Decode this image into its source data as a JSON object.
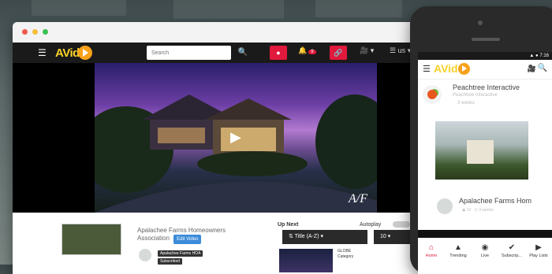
{
  "desktop": {
    "navbar": {
      "logo_text": "AVid",
      "search_placeholder": "Search",
      "notif_count": "9",
      "lang": "us"
    },
    "video": {
      "title": "Apalachee Farms Homeowners Association",
      "edit_label": "Edit Video",
      "channel_chip": "Apalachee Farms HOA",
      "subscribed_label": "Subscribed"
    },
    "up_next": {
      "label": "Up Next",
      "autoplay_label": "Autoplay",
      "sort_value": "Title (A-Z)",
      "count_value": "10",
      "next_title": "GLOBE",
      "next_meta": "Category"
    }
  },
  "phone": {
    "status_time": "7:16",
    "logo_text": "AVid",
    "channel": {
      "name": "Peachtree Interactive",
      "sub": "Peachtree Interactive",
      "time": "3 weeks"
    },
    "video": {
      "title": "Apalachee Farms Hom",
      "views": "12",
      "time": "3 weeks"
    },
    "tabs": [
      {
        "label": "Home"
      },
      {
        "label": "Trending"
      },
      {
        "label": "Live"
      },
      {
        "label": "Subscrip..."
      },
      {
        "label": "Play Lists"
      }
    ]
  },
  "colors": {
    "accent_red": "#e1193c",
    "logo_yellow": "#f7d22a",
    "logo_orange": "#f7a21a",
    "navbar": "#1a1a1a"
  }
}
